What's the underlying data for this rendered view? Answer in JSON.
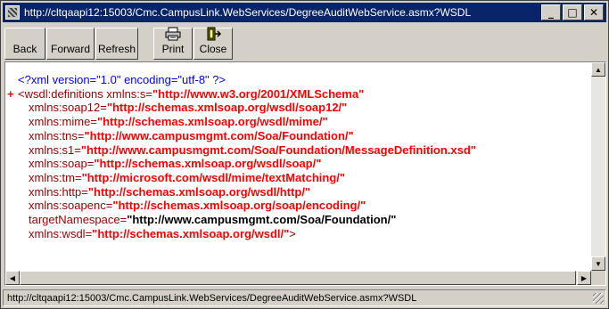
{
  "window": {
    "title": "http://cltqaapi12:15003/Cmc.CampusLink.WebServices/DegreeAuditWebService.asmx?WSDL",
    "controls": {
      "minimize": "_",
      "maximize": "□",
      "close": "✕"
    }
  },
  "toolbar": {
    "back_label": "Back",
    "forward_label": "Forward",
    "refresh_label": "Refresh",
    "print_label": "Print",
    "close_label": "Close"
  },
  "xml": {
    "declaration": "<?xml version=\"1.0\" encoding=\"utf-8\" ?>",
    "collapse_marker": "+",
    "root_open": "<wsdl:definitions xmlns:s=",
    "root_value": "\"http://www.w3.org/2001/XMLSchema\"",
    "attributes": [
      {
        "name": "xmlns:soap12=",
        "value": "\"http://schemas.xmlsoap.org/wsdl/soap12/\"",
        "style": "red"
      },
      {
        "name": "xmlns:mime=",
        "value": "\"http://schemas.xmlsoap.org/wsdl/mime/\"",
        "style": "red"
      },
      {
        "name": "xmlns:tns=",
        "value": "\"http://www.campusmgmt.com/Soa/Foundation/\"",
        "style": "red"
      },
      {
        "name": "xmlns:s1=",
        "value": "\"http://www.campusmgmt.com/Soa/Foundation/MessageDefinition.xsd\"",
        "style": "red"
      },
      {
        "name": "xmlns:soap=",
        "value": "\"http://schemas.xmlsoap.org/wsdl/soap/\"",
        "style": "red"
      },
      {
        "name": "xmlns:tm=",
        "value": "\"http://microsoft.com/wsdl/mime/textMatching/\"",
        "style": "red"
      },
      {
        "name": "xmlns:http=",
        "value": "\"http://schemas.xmlsoap.org/wsdl/http/\"",
        "style": "red"
      },
      {
        "name": "xmlns:soapenc=",
        "value": "\"http://schemas.xmlsoap.org/soap/encoding/\"",
        "style": "red"
      },
      {
        "name": "targetNamespace=",
        "value": "\"http://www.campusmgmt.com/Soa/Foundation/\"",
        "style": "black"
      },
      {
        "name": "xmlns:wsdl=",
        "value": "\"http://schemas.xmlsoap.org/wsdl/\"",
        "style": "red",
        "suffix": ">"
      }
    ]
  },
  "status": {
    "text": "http://cltqaapi12:15003/Cmc.CampusLink.WebServices/DegreeAuditWebService.asmx?WSDL"
  },
  "colors": {
    "titlebar": "#0a246a",
    "xml_tag": "#990000",
    "xml_value": "#ff0000",
    "xml_declaration": "#0000ff"
  }
}
